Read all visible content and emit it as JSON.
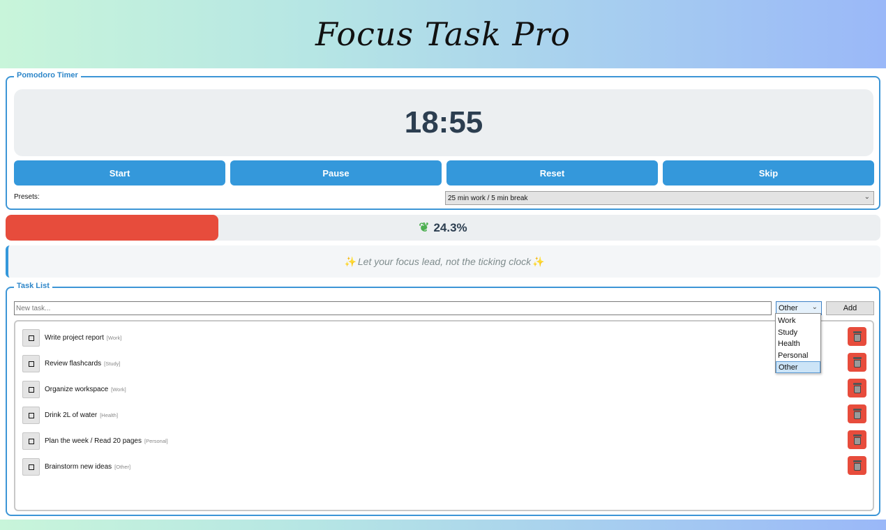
{
  "app": {
    "title": "Focus Task Pro"
  },
  "pomodoro": {
    "group_title": "Pomodoro Timer",
    "time": "18:55",
    "buttons": {
      "start": "Start",
      "pause": "Pause",
      "reset": "Reset",
      "skip": "Skip"
    },
    "presets_label": "Presets:",
    "preset_selected": "25 min work / 5 min break"
  },
  "progress": {
    "percent": 24.3,
    "label": "24.3%",
    "fill_color": "#e74c3c",
    "icon": "leaf-icon"
  },
  "quote": {
    "text": "Let your focus lead, not the ticking clock",
    "icon": "sparkle-icon"
  },
  "tasks": {
    "group_title": "Task List",
    "input_placeholder": "New task...",
    "category_selected": "Other",
    "add_label": "Add",
    "category_options": [
      "Work",
      "Study",
      "Health",
      "Personal",
      "Other"
    ],
    "items": [
      {
        "text": "Write project report",
        "category": "[Work]"
      },
      {
        "text": "Review flashcards",
        "category": "[Study]"
      },
      {
        "text": "Organize workspace",
        "category": "[Work]"
      },
      {
        "text": "Drink 2L of water",
        "category": "[Health]"
      },
      {
        "text": "Plan the week / Read 20 pages",
        "category": "[Personal]"
      },
      {
        "text": "Brainstorm new ideas",
        "category": "[Other]"
      }
    ]
  },
  "colors": {
    "accent": "#3498db",
    "danger": "#e74c3c",
    "timer_text": "#2c3e50"
  }
}
